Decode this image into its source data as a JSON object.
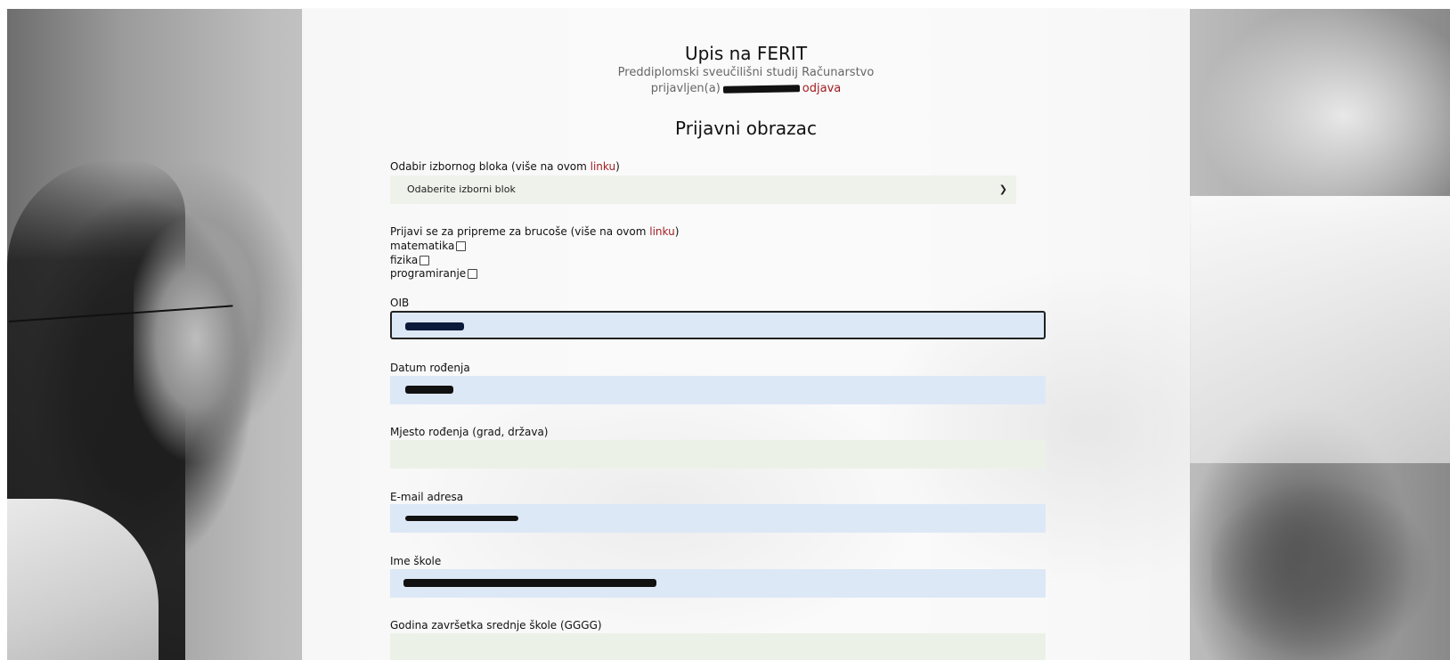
{
  "header": {
    "title": "Upis na FERIT",
    "subtitle": "Preddiplomski sveučilišni studij Računarstvo",
    "logged_in_prefix": "prijavljen(a)",
    "logout_label": "odjava"
  },
  "form": {
    "title": "Prijavni obrazac",
    "block": {
      "label_prefix": "Odabir izbornog bloka (više na ovom ",
      "link": "linku",
      "label_suffix": ")",
      "selected": "Odaberite izborni blok"
    },
    "prep": {
      "label_prefix": "Prijavi se za pripreme za brucoše (više na ovom ",
      "link": "linku",
      "label_suffix": ")",
      "options": [
        "matematika",
        "fizika",
        "programiranje"
      ]
    },
    "fields": {
      "oib": "OIB",
      "birth_date": "Datum rođenja",
      "birth_place": "Mjesto rođenja (grad, država)",
      "email": "E-mail adresa",
      "school": "Ime škole",
      "graduation_year": "Godina završetka srednje škole (GGGG)"
    }
  },
  "colors": {
    "link": "#a11d21",
    "field_filled": "#dde8f6",
    "field_empty": "#ecf1e8"
  }
}
